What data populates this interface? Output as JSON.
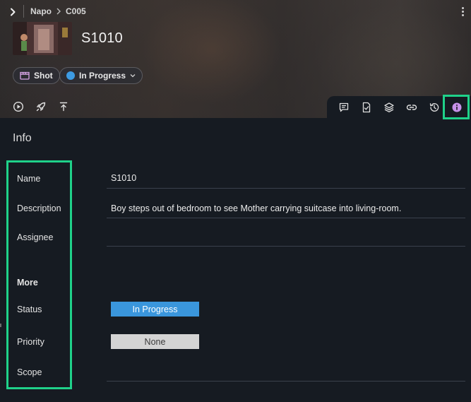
{
  "breadcrumb": [
    "Napo",
    "C005"
  ],
  "entity": {
    "title": "S1010",
    "type_label": "Shot",
    "status_label": "In Progress",
    "status_color": "#3d9be3"
  },
  "actions": [
    "play-icon",
    "rocket-icon",
    "upload-icon"
  ],
  "tabs": [
    "comments-icon",
    "task-check-icon",
    "layers-icon",
    "link-icon",
    "history-icon",
    "info-icon"
  ],
  "info": {
    "title": "Info",
    "fields": {
      "name": {
        "label": "Name",
        "value": "S1010"
      },
      "description": {
        "label": "Description",
        "value": "Boy steps out of bedroom to see Mother carrying suitcase into living-room."
      },
      "assignee": {
        "label": "Assignee",
        "value": ""
      }
    },
    "more": {
      "heading": "More",
      "status": {
        "label": "Status",
        "value": "In Progress"
      },
      "priority": {
        "label": "Priority",
        "value": "None"
      },
      "scope": {
        "label": "Scope",
        "value": ""
      }
    }
  },
  "colors": {
    "accent_highlight": "#1fd18a",
    "status_in_progress": "#3a96dc",
    "priority_none": "#d4d4d4",
    "tab_active": "#c792ea",
    "background": "#161b22"
  }
}
